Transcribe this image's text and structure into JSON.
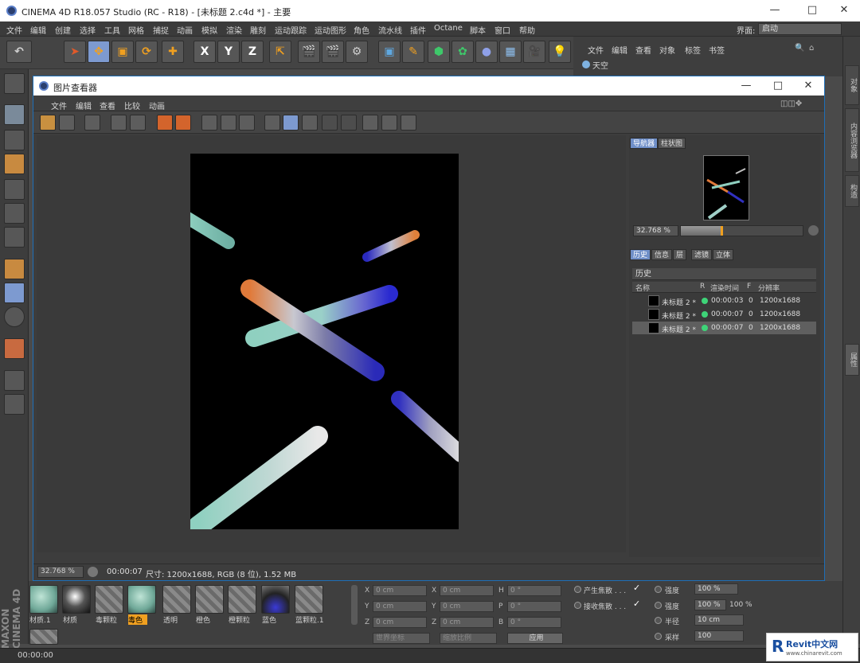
{
  "app": {
    "title": "CINEMA 4D R18.057 Studio (RC - R18) - [未标题 2.c4d *] - 主要",
    "menus": [
      "文件",
      "编辑",
      "创建",
      "选择",
      "工具",
      "网格",
      "捕捉",
      "动画",
      "模拟",
      "渲染",
      "雕刻",
      "运动跟踪",
      "运动图形",
      "角色",
      "流水线",
      "插件",
      "Octane",
      "脚本",
      "窗口",
      "帮助"
    ],
    "layout_label": "界面:",
    "layout_value": "启动",
    "toolbar_axes": [
      "X",
      "Y",
      "Z"
    ]
  },
  "object_manager": {
    "menus": [
      "文件",
      "编辑",
      "查看",
      "对象",
      "标签",
      "书签"
    ],
    "item": "天空"
  },
  "right_tabs": [
    "对象",
    "内容浏览器",
    "构造",
    "属性"
  ],
  "picture_viewer": {
    "title": "图片查看器",
    "menus": [
      "文件",
      "编辑",
      "查看",
      "比较",
      "动画"
    ],
    "nav_tabs": [
      "导航器",
      "柱状图"
    ],
    "zoom": "32.768 %",
    "zoom_fraction": 0.33,
    "info_tabs": [
      "历史",
      "信息",
      "层",
      "滤镜",
      "立体"
    ],
    "history_title": "历史",
    "columns": [
      "名称",
      "R",
      "渲染时间",
      "F",
      "分辨率"
    ],
    "rows": [
      {
        "name": "未标题 2 *",
        "time": "00:00:03",
        "f": "0",
        "res": "1200x1688"
      },
      {
        "name": "未标题 2 *",
        "time": "00:00:07",
        "f": "0",
        "res": "1200x1688"
      },
      {
        "name": "未标题 2 *",
        "time": "00:00:07",
        "f": "0",
        "res": "1200x1688"
      }
    ],
    "status_zoom": "32.768 %",
    "status_time": "00:00:07",
    "status_info": "尺寸: 1200x1688, RGB (8 位), 1.52 MB"
  },
  "materials": [
    "材质.1",
    "材质",
    "毒颗粒",
    "毒色",
    "透明",
    "橙色",
    "橙颗粒",
    "蓝色",
    "蓝颗粒.1"
  ],
  "selected_material_index": 3,
  "coords": {
    "labels": [
      "X",
      "Y",
      "Z",
      "X",
      "Y",
      "Z",
      "H",
      "P",
      "B"
    ],
    "values": [
      "0 cm",
      "0 cm",
      "0 cm",
      "0 cm",
      "0 cm",
      "0 cm",
      "0 °",
      "0 °",
      "0 °"
    ],
    "world": "世界坐标",
    "scale": "缩放比例",
    "apply": "应用"
  },
  "properties": {
    "cast_caustics": "产生焦散 . . .",
    "receive_caustics": "接收焦散 . . .",
    "strength1_label": "强度",
    "strength1_value": "100 %",
    "strength2_label": "强度",
    "strength2_value": "100 %",
    "strength2_value_b": "100 %",
    "radius_label": "半径",
    "radius_value": "10 cm",
    "samples_label": "采样",
    "samples_value": "100"
  },
  "status_time": "00:00:00",
  "watermark": {
    "brand": "Revit中文网",
    "url": "www.chinarevit.com"
  }
}
